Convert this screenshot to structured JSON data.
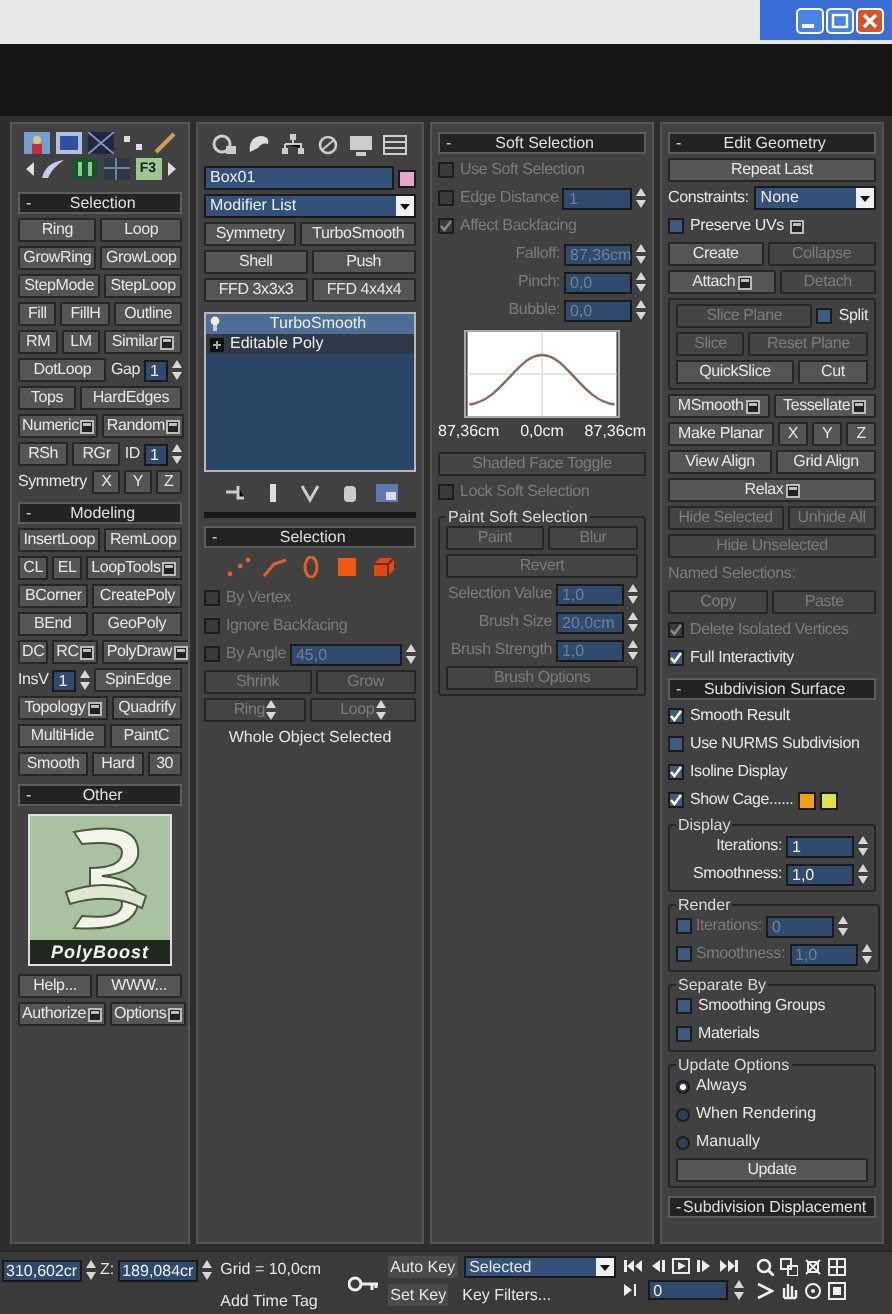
{
  "columns": [
    {
      "items": [
        {
          "kind": "toolbar",
          "label": "F3"
        },
        {
          "kind": "rollout",
          "sign": "-",
          "title": "Selection"
        },
        {
          "kind": "row",
          "cells": [
            {
              "kind": "button",
              "label": "Ring"
            },
            {
              "kind": "button",
              "label": "Loop"
            }
          ]
        },
        {
          "kind": "row",
          "cells": [
            {
              "kind": "button",
              "label": "GrowRing"
            },
            {
              "kind": "button",
              "label": "GrowLoop"
            }
          ]
        },
        {
          "kind": "row",
          "cells": [
            {
              "kind": "button",
              "label": "StepMode"
            },
            {
              "kind": "button",
              "label": "StepLoop"
            }
          ]
        },
        {
          "kind": "row",
          "cells": [
            {
              "kind": "button",
              "label": "Fill"
            },
            {
              "kind": "button",
              "label": "FillH"
            },
            {
              "kind": "button",
              "label": "Outline"
            }
          ]
        },
        {
          "kind": "row",
          "cells": [
            {
              "kind": "button",
              "label": "RM"
            },
            {
              "kind": "button",
              "label": "LM"
            },
            {
              "kind": "button",
              "label": "Similar",
              "options": true
            }
          ]
        },
        {
          "kind": "row",
          "cells": [
            {
              "kind": "button",
              "label": "DotLoop"
            },
            {
              "kind": "spinner",
              "label": "Gap",
              "value": "1"
            }
          ]
        },
        {
          "kind": "row",
          "cells": [
            {
              "kind": "button",
              "label": "Tops"
            },
            {
              "kind": "button",
              "label": "HardEdges"
            }
          ]
        },
        {
          "kind": "row",
          "cells": [
            {
              "kind": "button",
              "label": "Numeric",
              "options": true
            },
            {
              "kind": "button",
              "label": "Random",
              "options": true
            }
          ]
        },
        {
          "kind": "row",
          "cells": [
            {
              "kind": "button",
              "label": "RSh"
            },
            {
              "kind": "button",
              "label": "RGr"
            },
            {
              "kind": "spinner",
              "label": "ID",
              "value": "1"
            }
          ]
        },
        {
          "kind": "row",
          "cells": [
            {
              "kind": "label",
              "text": "Symmetry"
            },
            {
              "kind": "button",
              "label": "X"
            },
            {
              "kind": "button",
              "label": "Y"
            },
            {
              "kind": "button",
              "label": "Z"
            }
          ]
        },
        {
          "kind": "rollout",
          "sign": "-",
          "title": "Modeling"
        },
        {
          "kind": "row",
          "cells": [
            {
              "kind": "button",
              "label": "InsertLoop"
            },
            {
              "kind": "button",
              "label": "RemLoop"
            }
          ]
        },
        {
          "kind": "row",
          "cells": [
            {
              "kind": "button",
              "label": "CL"
            },
            {
              "kind": "button",
              "label": "EL"
            },
            {
              "kind": "button",
              "label": "LoopTools",
              "options": true
            }
          ]
        },
        {
          "kind": "row",
          "cells": [
            {
              "kind": "button",
              "label": "BCorner"
            },
            {
              "kind": "button",
              "label": "CreatePoly"
            }
          ]
        },
        {
          "kind": "row",
          "cells": [
            {
              "kind": "button",
              "label": "BEnd"
            },
            {
              "kind": "button",
              "label": "GeoPoly"
            }
          ]
        },
        {
          "kind": "row",
          "cells": [
            {
              "kind": "button",
              "label": "DC"
            },
            {
              "kind": "button",
              "label": "RC",
              "options": true
            },
            {
              "kind": "button",
              "label": "PolyDraw",
              "options": true
            }
          ]
        },
        {
          "kind": "row",
          "cells": [
            {
              "kind": "spinner",
              "label": "InsV",
              "value": "1"
            },
            {
              "kind": "button",
              "label": "SpinEdge"
            }
          ]
        },
        {
          "kind": "row",
          "cells": [
            {
              "kind": "button",
              "label": "Topology",
              "options": true
            },
            {
              "kind": "button",
              "label": "Quadrify"
            }
          ]
        },
        {
          "kind": "row",
          "cells": [
            {
              "kind": "button",
              "label": "MultiHide"
            },
            {
              "kind": "button",
              "label": "PaintC"
            }
          ]
        },
        {
          "kind": "row",
          "cells": [
            {
              "kind": "button",
              "label": "Smooth"
            },
            {
              "kind": "button",
              "label": "Hard"
            },
            {
              "kind": "button",
              "label": "30"
            }
          ]
        },
        {
          "kind": "rollout",
          "sign": "-",
          "title": "Other"
        },
        {
          "kind": "logo",
          "text": "PolyBoost"
        },
        {
          "kind": "row",
          "cells": [
            {
              "kind": "button",
              "label": "Help..."
            },
            {
              "kind": "button",
              "label": "WWW..."
            }
          ]
        },
        {
          "kind": "row",
          "cells": [
            {
              "kind": "button",
              "label": "Authorize",
              "options": true
            },
            {
              "kind": "button",
              "label": "Options",
              "options": true
            }
          ]
        }
      ]
    },
    {
      "items": [
        {
          "kind": "tabs"
        },
        {
          "kind": "row",
          "cells": [
            {
              "kind": "field",
              "value": "Box01"
            },
            {
              "kind": "swatch",
              "color": "#e6a6c8"
            }
          ]
        },
        {
          "kind": "row",
          "cells": [
            {
              "kind": "dropdown",
              "value": "Modifier List"
            }
          ]
        },
        {
          "kind": "row",
          "cells": [
            {
              "kind": "button",
              "label": "Symmetry"
            },
            {
              "kind": "button",
              "label": "TurboSmooth"
            }
          ]
        },
        {
          "kind": "row",
          "cells": [
            {
              "kind": "button",
              "label": "Shell"
            },
            {
              "kind": "button",
              "label": "Push"
            }
          ]
        },
        {
          "kind": "row",
          "cells": [
            {
              "kind": "button",
              "label": "FFD 3x3x3"
            },
            {
              "kind": "button",
              "label": "FFD 4x4x4"
            }
          ]
        },
        {
          "kind": "stack",
          "items": [
            {
              "kind": "modifier",
              "label": "TurboSmooth",
              "selected": true
            },
            {
              "kind": "object",
              "label": "Editable Poly",
              "selected": false
            }
          ]
        },
        {
          "kind": "stack_tools"
        },
        {
          "kind": "rollout",
          "sign": "-",
          "title": "Selection"
        },
        {
          "kind": "subobjects"
        },
        {
          "kind": "row",
          "cells": [
            {
              "kind": "check",
              "label": "By Vertex",
              "checked": false,
              "disabled": true
            }
          ]
        },
        {
          "kind": "row",
          "cells": [
            {
              "kind": "check",
              "label": "Ignore Backfacing",
              "checked": false,
              "disabled": true
            }
          ]
        },
        {
          "kind": "row",
          "cells": [
            {
              "kind": "check",
              "label": "By Angle",
              "checked": false,
              "disabled": true
            },
            {
              "kind": "spinner",
              "value": "45,0",
              "disabled": true
            }
          ]
        },
        {
          "kind": "row",
          "cells": [
            {
              "kind": "button",
              "label": "Shrink",
              "disabled": true
            },
            {
              "kind": "button",
              "label": "Grow",
              "disabled": true
            }
          ]
        },
        {
          "kind": "row",
          "cells": [
            {
              "kind": "button",
              "label": "Ring",
              "disabled": true,
              "stepper": true
            },
            {
              "kind": "button",
              "label": "Loop",
              "disabled": true,
              "stepper": true
            }
          ]
        },
        {
          "kind": "note",
          "text": "Whole Object Selected"
        }
      ]
    },
    {
      "items": [
        {
          "kind": "rollout",
          "sign": "-",
          "title": "Soft Selection"
        },
        {
          "kind": "row",
          "cells": [
            {
              "kind": "check",
              "label": "Use Soft Selection",
              "checked": false,
              "disabled": true
            }
          ]
        },
        {
          "kind": "row",
          "cells": [
            {
              "kind": "check",
              "label": "Edge Distance",
              "checked": false,
              "disabled": true
            },
            {
              "kind": "spinner",
              "value": "1",
              "disabled": true
            }
          ]
        },
        {
          "kind": "row",
          "cells": [
            {
              "kind": "check",
              "label": "Affect Backfacing",
              "checked": true,
              "disabled": true
            }
          ]
        },
        {
          "kind": "row",
          "cells": [
            {
              "kind": "spinner",
              "label": "Falloff:",
              "value": "87,36cm",
              "disabled": true
            }
          ]
        },
        {
          "kind": "row",
          "cells": [
            {
              "kind": "spinner",
              "label": "Pinch:",
              "value": "0,0",
              "disabled": true
            }
          ]
        },
        {
          "kind": "row",
          "cells": [
            {
              "kind": "spinner",
              "label": "Bubble:",
              "value": "0,0",
              "disabled": true
            }
          ]
        },
        {
          "kind": "curve",
          "labels": [
            "87,36cm",
            "0,0cm",
            "87,36cm"
          ]
        },
        {
          "kind": "row",
          "cells": [
            {
              "kind": "button",
              "label": "Shaded Face Toggle",
              "disabled": true
            }
          ]
        },
        {
          "kind": "row",
          "cells": [
            {
              "kind": "check",
              "label": "Lock Soft Selection",
              "checked": false,
              "disabled": true
            }
          ]
        },
        {
          "kind": "group",
          "title": "Paint Soft Selection",
          "rows": [
            {
              "cells": [
                {
                  "kind": "button",
                  "label": "Paint",
                  "disabled": true
                },
                {
                  "kind": "button",
                  "label": "Blur",
                  "disabled": true
                }
              ]
            },
            {
              "cells": [
                {
                  "kind": "button",
                  "label": "Revert",
                  "disabled": true
                }
              ]
            },
            {
              "cells": [
                {
                  "kind": "spinner",
                  "label": "Selection Value",
                  "value": "1,0",
                  "disabled": true
                }
              ]
            },
            {
              "cells": [
                {
                  "kind": "spinner",
                  "label": "Brush Size",
                  "value": "20,0cm",
                  "disabled": true
                }
              ]
            },
            {
              "cells": [
                {
                  "kind": "spinner",
                  "label": "Brush Strength",
                  "value": "1,0",
                  "disabled": true
                }
              ]
            },
            {
              "cells": [
                {
                  "kind": "button",
                  "label": "Brush Options",
                  "disabled": true
                }
              ]
            }
          ]
        }
      ]
    },
    {
      "items": [
        {
          "kind": "rollout",
          "sign": "-",
          "title": "Edit Geometry"
        },
        {
          "kind": "row",
          "cells": [
            {
              "kind": "button",
              "label": "Repeat Last",
              "disabled": false
            }
          ]
        },
        {
          "kind": "row",
          "cells": [
            {
              "kind": "label",
              "text": "Constraints:",
              "disabled": false
            },
            {
              "kind": "dropdown",
              "value": "None"
            }
          ]
        },
        {
          "kind": "row",
          "cells": [
            {
              "kind": "check",
              "label": "Preserve UVs",
              "checked": false,
              "disabled": false,
              "options": true
            }
          ]
        },
        {
          "kind": "row",
          "cells": [
            {
              "kind": "button",
              "label": "Create",
              "disabled": false
            },
            {
              "kind": "button",
              "label": "Collapse",
              "disabled": true
            }
          ]
        },
        {
          "kind": "row",
          "cells": [
            {
              "kind": "button",
              "label": "Attach",
              "disabled": false,
              "options": true
            },
            {
              "kind": "button",
              "label": "Detach",
              "disabled": true
            }
          ]
        },
        {
          "kind": "group",
          "rows": [
            {
              "cells": [
                {
                  "kind": "button",
                  "label": "Slice Plane",
                  "disabled": true
                },
                {
                  "kind": "check",
                  "label": "Split",
                  "checked": false,
                  "disabled": false
                }
              ]
            },
            {
              "cells": [
                {
                  "kind": "button",
                  "label": "Slice",
                  "disabled": true
                },
                {
                  "kind": "button",
                  "label": "Reset Plane",
                  "disabled": true
                }
              ]
            },
            {
              "cells": [
                {
                  "kind": "button",
                  "label": "QuickSlice",
                  "disabled": false
                },
                {
                  "kind": "button",
                  "label": "Cut",
                  "disabled": false
                }
              ]
            }
          ]
        },
        {
          "kind": "row",
          "cells": [
            {
              "kind": "button",
              "label": "MSmooth",
              "disabled": false,
              "options": true
            },
            {
              "kind": "button",
              "label": "Tessellate",
              "disabled": false,
              "options": true
            }
          ]
        },
        {
          "kind": "row",
          "cells": [
            {
              "kind": "button",
              "label": "Make Planar",
              "disabled": false
            },
            {
              "kind": "button",
              "label": "X",
              "disabled": false
            },
            {
              "kind": "button",
              "label": "Y",
              "disabled": false
            },
            {
              "kind": "button",
              "label": "Z",
              "disabled": false
            }
          ]
        },
        {
          "kind": "row",
          "cells": [
            {
              "kind": "button",
              "label": "View Align",
              "disabled": false
            },
            {
              "kind": "button",
              "label": "Grid Align",
              "disabled": false
            }
          ]
        },
        {
          "kind": "row",
          "cells": [
            {
              "kind": "button",
              "label": "Relax",
              "disabled": false,
              "options": true
            }
          ]
        },
        {
          "kind": "row",
          "cells": [
            {
              "kind": "button",
              "label": "Hide Selected",
              "disabled": true
            },
            {
              "kind": "button",
              "label": "Unhide All",
              "disabled": true
            }
          ]
        },
        {
          "kind": "row",
          "cells": [
            {
              "kind": "button",
              "label": "Hide Unselected",
              "disabled": true
            }
          ]
        },
        {
          "kind": "row",
          "cells": [
            {
              "kind": "label",
              "text": "Named Selections:",
              "disabled": true
            }
          ]
        },
        {
          "kind": "row",
          "cells": [
            {
              "kind": "button",
              "label": "Copy",
              "disabled": true
            },
            {
              "kind": "button",
              "label": "Paste",
              "disabled": true
            }
          ]
        },
        {
          "kind": "row",
          "cells": [
            {
              "kind": "check",
              "label": "Delete Isolated Vertices",
              "checked": true,
              "disabled": true
            }
          ]
        },
        {
          "kind": "row",
          "cells": [
            {
              "kind": "check",
              "label": "Full Interactivity",
              "checked": true,
              "disabled": false
            }
          ]
        },
        {
          "kind": "rollout",
          "sign": "-",
          "title": "Subdivision Surface"
        },
        {
          "kind": "row",
          "cells": [
            {
              "kind": "check",
              "label": "Smooth Result",
              "checked": true,
              "disabled": false
            }
          ]
        },
        {
          "kind": "row",
          "cells": [
            {
              "kind": "check",
              "label": "Use NURMS Subdivision",
              "checked": false,
              "disabled": false
            }
          ]
        },
        {
          "kind": "row",
          "cells": [
            {
              "kind": "check",
              "label": "Isoline Display",
              "checked": true,
              "disabled": false
            }
          ]
        },
        {
          "kind": "row",
          "cells": [
            {
              "kind": "check",
              "label": "Show Cage......",
              "checked": true,
              "disabled": false
            },
            {
              "kind": "swatch",
              "color": "#f0a018"
            },
            {
              "kind": "swatch",
              "color": "#e2e048"
            }
          ]
        },
        {
          "kind": "group",
          "title": "Display",
          "rows": [
            {
              "cells": [
                {
                  "kind": "spinner",
                  "label": "Iterations:",
                  "value": "1",
                  "disabled": false
                }
              ]
            },
            {
              "cells": [
                {
                  "kind": "spinner",
                  "label": "Smoothness:",
                  "value": "1,0",
                  "disabled": false
                }
              ]
            }
          ]
        },
        {
          "kind": "group",
          "title": "Render",
          "rows": [
            {
              "cells": [
                {
                  "kind": "check",
                  "checked": false,
                  "disabled": false
                },
                {
                  "kind": "spinner",
                  "label": "Iterations:",
                  "value": "0",
                  "disabled": true
                }
              ]
            },
            {
              "cells": [
                {
                  "kind": "check",
                  "checked": false,
                  "disabled": false
                },
                {
                  "kind": "spinner",
                  "label": "Smoothness:",
                  "value": "1,0",
                  "disabled": true
                }
              ]
            }
          ]
        },
        {
          "kind": "group",
          "title": "Separate By",
          "rows": [
            {
              "cells": [
                {
                  "kind": "check",
                  "label": "Smoothing Groups",
                  "checked": false,
                  "disabled": false
                }
              ]
            },
            {
              "cells": [
                {
                  "kind": "check",
                  "label": "Materials",
                  "checked": false,
                  "disabled": false
                }
              ]
            }
          ]
        },
        {
          "kind": "group",
          "title": "Update Options",
          "rows": [
            {
              "cells": [
                {
                  "kind": "radio",
                  "label": "Always",
                  "selected": true
                }
              ]
            },
            {
              "cells": [
                {
                  "kind": "radio",
                  "label": "When Rendering",
                  "selected": false
                }
              ]
            },
            {
              "cells": [
                {
                  "kind": "radio",
                  "label": "Manually",
                  "selected": false
                }
              ]
            },
            {
              "cells": [
                {
                  "kind": "button",
                  "label": "Update",
                  "disabled": false
                }
              ]
            }
          ]
        },
        {
          "kind": "rollout",
          "sign": "-",
          "title": "Subdivision Displacement"
        }
      ]
    }
  ],
  "status_bar": {
    "x": "310,602cr",
    "z_label": "Z:",
    "z": "189,084cr",
    "grid": "Grid = 10,0cm",
    "time_tag": "Add Time Tag",
    "auto_key": "Auto Key",
    "key_mode": "Selected",
    "set_key": "Set Key",
    "key_filters": "Key Filters...",
    "frame": "0"
  }
}
